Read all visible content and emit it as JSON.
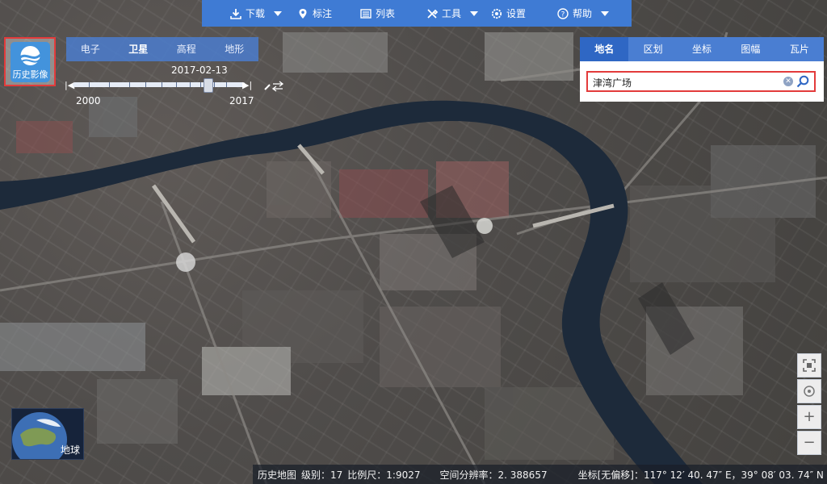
{
  "toolbar": {
    "items": [
      {
        "label": "下载",
        "icon": "download-icon",
        "has_dropdown": true
      },
      {
        "label": "标注",
        "icon": "marker-icon",
        "has_dropdown": false
      },
      {
        "label": "列表",
        "icon": "list-icon",
        "has_dropdown": false
      },
      {
        "label": "工具",
        "icon": "tools-icon",
        "has_dropdown": true
      },
      {
        "label": "设置",
        "icon": "settings-icon",
        "has_dropdown": false
      },
      {
        "label": "帮助",
        "icon": "help-icon",
        "has_dropdown": true
      }
    ]
  },
  "history_button": {
    "label": "历史影像",
    "icon": "history-image-icon"
  },
  "layer_switcher": {
    "tabs": [
      "电子",
      "卫星",
      "高程",
      "地形"
    ],
    "active": "卫星"
  },
  "time_slider": {
    "current_date": "2017-02-13",
    "start_year": "2000",
    "end_year": "2017"
  },
  "search_panel": {
    "tabs": [
      "地名",
      "区划",
      "坐标",
      "图幅",
      "瓦片"
    ],
    "active": "地名",
    "query": "津湾广场"
  },
  "zoom_controls": {
    "buttons": [
      {
        "icon": "fullscreen-icon"
      },
      {
        "icon": "locate-icon"
      },
      {
        "label": "+",
        "icon": "zoom-in-icon"
      },
      {
        "label": "−",
        "icon": "zoom-out-icon"
      }
    ]
  },
  "globe_button": {
    "label": "地球",
    "icon": "globe-icon"
  },
  "status_bar": {
    "map_name": "历史地图",
    "level": "级别：17",
    "scale": "比例尺：1:9027",
    "resolution": "空间分辨率：2. 388657",
    "coordinates": "坐标[无偏移]：117° 12′ 40. 47″ E，39° 08′ 03. 74″ N"
  },
  "colors": {
    "toolbar": "#3f7bd4",
    "highlight_border": "#e33b3b",
    "river": "#1d2a3a"
  }
}
